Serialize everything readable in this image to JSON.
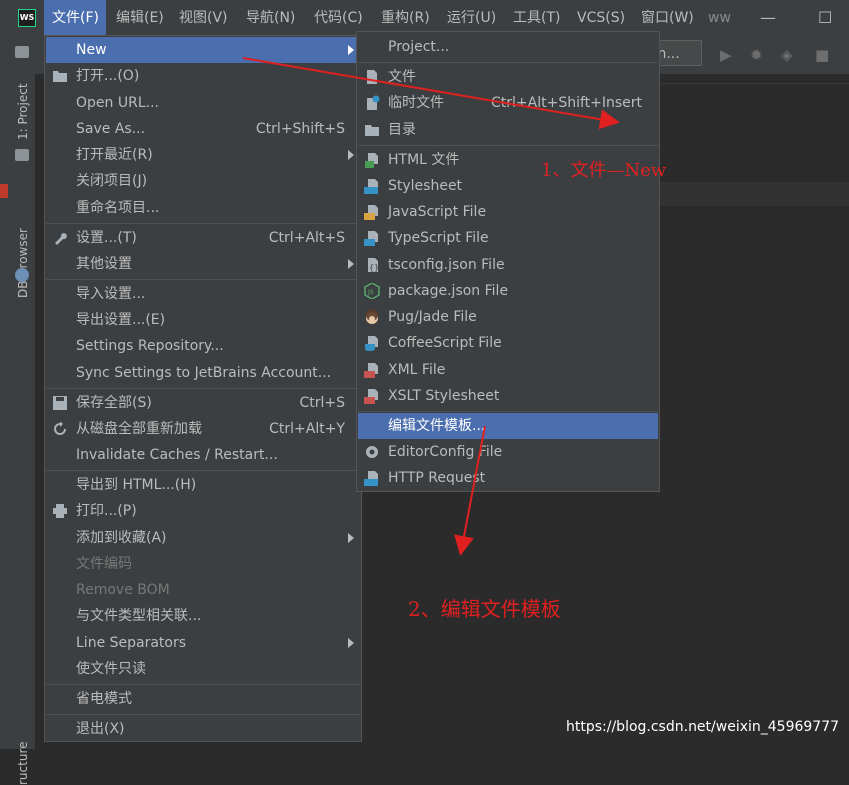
{
  "menubar": {
    "app_logo": "WS",
    "items": [
      "文件(F)",
      "编辑(E)",
      "视图(V)",
      "导航(N)",
      "代码(C)",
      "重构(R)",
      "运行(U)",
      "工具(T)",
      "VCS(S)",
      "窗口(W)",
      "ww"
    ],
    "minimize": "—",
    "maximize": "☐"
  },
  "toolbar": {
    "combo_text": "ion...",
    "icons": [
      "play-icon",
      "debug-icon",
      "coverage-icon",
      "stop-icon"
    ]
  },
  "left_strip": {
    "project_label": "1: Project",
    "db_label": "DB Browser",
    "structure_label": "ructure"
  },
  "file_menu": {
    "items": [
      {
        "label": "New",
        "shortcut": "",
        "submenu": true,
        "selected": true,
        "icon": ""
      },
      {
        "label": "打开...(O)",
        "shortcut": "",
        "submenu": false,
        "icon": "folder-open-icon"
      },
      {
        "label": "Open URL...",
        "shortcut": "",
        "submenu": false,
        "icon": ""
      },
      {
        "label": "Save As...",
        "shortcut": "Ctrl+Shift+S",
        "submenu": false,
        "icon": ""
      },
      {
        "label": "打开最近(R)",
        "shortcut": "",
        "submenu": true,
        "icon": ""
      },
      {
        "label": "关闭项目(J)",
        "shortcut": "",
        "submenu": false,
        "icon": ""
      },
      {
        "label": "重命名项目...",
        "shortcut": "",
        "submenu": false,
        "icon": ""
      },
      {
        "label": "设置...(T)",
        "shortcut": "Ctrl+Alt+S",
        "submenu": false,
        "icon": "wrench-icon"
      },
      {
        "label": "其他设置",
        "shortcut": "",
        "submenu": true,
        "icon": ""
      },
      {
        "label": "导入设置...",
        "shortcut": "",
        "submenu": false,
        "icon": ""
      },
      {
        "label": "导出设置...(E)",
        "shortcut": "",
        "submenu": false,
        "icon": ""
      },
      {
        "label": "Settings Repository...",
        "shortcut": "",
        "submenu": false,
        "icon": ""
      },
      {
        "label": "Sync Settings to JetBrains Account...",
        "shortcut": "",
        "submenu": false,
        "icon": ""
      },
      {
        "label": "保存全部(S)",
        "shortcut": "Ctrl+S",
        "submenu": false,
        "icon": "save-icon"
      },
      {
        "label": "从磁盘全部重新加载",
        "shortcut": "Ctrl+Alt+Y",
        "submenu": false,
        "icon": "reload-icon"
      },
      {
        "label": "Invalidate Caches / Restart...",
        "shortcut": "",
        "submenu": false,
        "icon": ""
      },
      {
        "label": "导出到 HTML...(H)",
        "shortcut": "",
        "submenu": false,
        "icon": ""
      },
      {
        "label": "打印...(P)",
        "shortcut": "",
        "submenu": false,
        "icon": "print-icon"
      },
      {
        "label": "添加到收藏(A)",
        "shortcut": "",
        "submenu": true,
        "icon": ""
      },
      {
        "label": "文件编码",
        "shortcut": "",
        "submenu": false,
        "disabled": true,
        "icon": ""
      },
      {
        "label": "Remove BOM",
        "shortcut": "",
        "submenu": false,
        "disabled": true,
        "icon": ""
      },
      {
        "label": "与文件类型相关联...",
        "shortcut": "",
        "submenu": false,
        "icon": ""
      },
      {
        "label": "Line Separators",
        "shortcut": "",
        "submenu": true,
        "icon": ""
      },
      {
        "label": "使文件只读",
        "shortcut": "",
        "submenu": false,
        "icon": ""
      },
      {
        "label": "省电模式",
        "shortcut": "",
        "submenu": false,
        "icon": ""
      },
      {
        "label": "退出(X)",
        "shortcut": "",
        "submenu": false,
        "icon": ""
      }
    ]
  },
  "new_submenu": {
    "items": [
      {
        "label": "Project...",
        "shortcut": "",
        "icon": ""
      },
      {
        "label": "文件",
        "shortcut": "",
        "icon": "file-icon"
      },
      {
        "label": "临时文件",
        "shortcut": "Ctrl+Alt+Shift+Insert",
        "icon": "scratch-file-icon"
      },
      {
        "label": "目录",
        "shortcut": "",
        "icon": "folder-icon"
      },
      {
        "label": "HTML 文件",
        "shortcut": "",
        "icon": "html-file-icon"
      },
      {
        "label": "Stylesheet",
        "shortcut": "",
        "icon": "css-file-icon"
      },
      {
        "label": "JavaScript File",
        "shortcut": "",
        "icon": "javascript-file-icon"
      },
      {
        "label": "TypeScript File",
        "shortcut": "",
        "icon": "typescript-file-icon"
      },
      {
        "label": "tsconfig.json File",
        "shortcut": "",
        "icon": "tsconfig-file-icon"
      },
      {
        "label": "package.json File",
        "shortcut": "",
        "icon": "nodejs-icon"
      },
      {
        "label": "Pug/Jade File",
        "shortcut": "",
        "icon": "pug-icon"
      },
      {
        "label": "CoffeeScript File",
        "shortcut": "",
        "icon": "coffeescript-icon"
      },
      {
        "label": "XML File",
        "shortcut": "",
        "icon": "xml-file-icon"
      },
      {
        "label": "XSLT Stylesheet",
        "shortcut": "",
        "icon": "xslt-file-icon"
      },
      {
        "label": "编辑文件模板...",
        "shortcut": "",
        "icon": "",
        "selected": true
      },
      {
        "label": "EditorConfig File",
        "shortcut": "",
        "icon": "gear-icon"
      },
      {
        "label": "HTTP Request",
        "shortcut": "",
        "icon": "api-file-icon"
      }
    ]
  },
  "annotations": {
    "step1": "1、文件—New",
    "step2": "2、编辑文件模板"
  },
  "watermark": "https://blog.csdn.net/weixin_45969777",
  "colors": {
    "menu_bg": "#3c3f41",
    "selection": "#4b6eaf",
    "text": "#bbbbbb",
    "annotation": "#e02020"
  }
}
